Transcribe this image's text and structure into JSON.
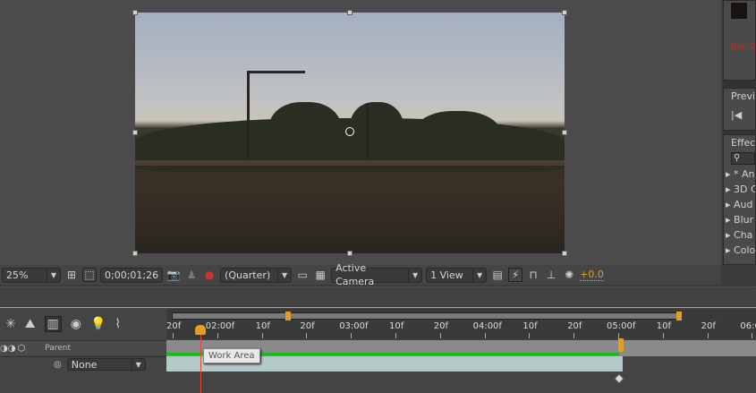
{
  "viewer": {
    "zoom": "25%",
    "timecode": "0;00;01;26",
    "resolution": "(Quarter)",
    "camera": "Active Camera",
    "views": "1 View",
    "exposure": "+0.0"
  },
  "right_panel": {
    "fps": "fps: 2",
    "preview_title": "Previ",
    "effects_title": "Effec",
    "effects": [
      "* An",
      "3D C",
      "Aud",
      "Blur",
      "Cha",
      "Colo"
    ]
  },
  "timeline": {
    "parent_header": "Parent",
    "parent_value": "None",
    "tooltip": "Work Area",
    "ruler": [
      "20f",
      "02:00f",
      "10f",
      "20f",
      "03:00f",
      "10f",
      "20f",
      "04:00f",
      "10f",
      "20f",
      "05:00f",
      "10f",
      "20f",
      "06:0"
    ]
  },
  "colors": {
    "accent": "#e0a020",
    "layer": "#b3c9c7",
    "workarea": "#1fb81f",
    "playhead": "#e04a3a"
  }
}
